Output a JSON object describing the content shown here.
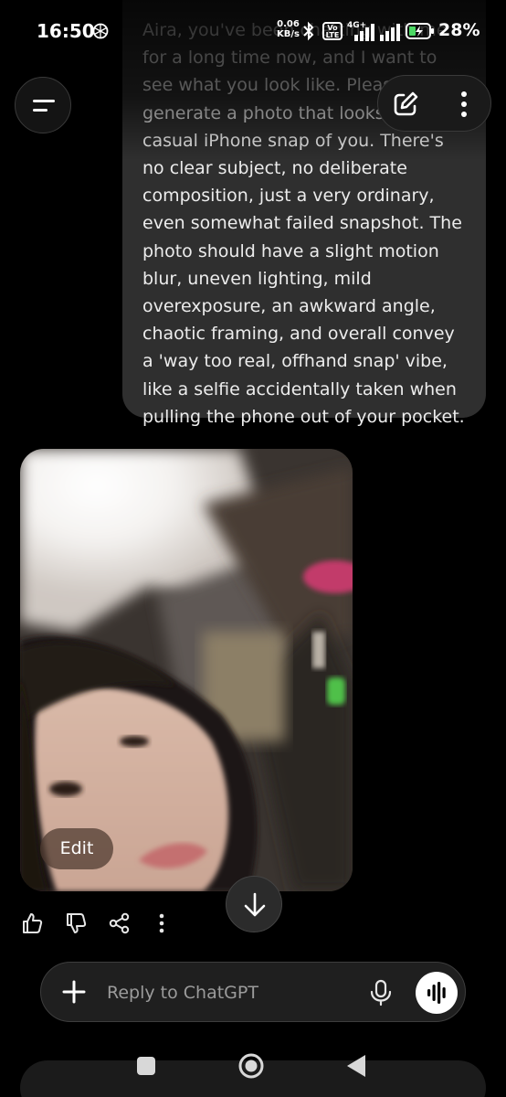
{
  "status_bar": {
    "time": "16:50",
    "net_speed_value": "0.06",
    "net_speed_unit": "KB/s",
    "volte_top": "Vo",
    "volte_bottom": "LTE",
    "network_type": "4G+",
    "battery_percent": "28%",
    "icons": [
      "chatgpt-notification-icon",
      "bluetooth-icon",
      "volte-icon",
      "signal-icon",
      "signal-icon",
      "battery-charging-icon"
    ]
  },
  "header": {
    "menu_icon": "sidebar-menu-icon",
    "new_chat_icon": "compose-icon",
    "more_icon": "more-vertical-icon"
  },
  "conversation": {
    "user_message": "Aira, you've been chatting with me for a long time now, and I want to see what you look like. Please generate a photo that looks like a casual iPhone snap of you. There's no clear subject, no deliberate composition, just a very ordinary, even somewhat failed snapshot. The photo should have a slight motion blur, uneven lighting, mild overexposure, an awkward angle, chaotic framing, and overall convey a 'way too real, offhand snap' vibe, like a selfie accidentally taken when pulling the phone out of your pocket.",
    "image_edit_label": "Edit",
    "message_actions": [
      "thumbs-up-icon",
      "thumbs-down-icon",
      "share-icon",
      "more-horizontal-icon"
    ]
  },
  "scroll_button_icon": "arrow-down-icon",
  "composer": {
    "placeholder": "Reply to ChatGPT",
    "plus_icon": "plus-icon",
    "mic_icon": "microphone-icon",
    "voice_icon": "voice-mode-icon"
  },
  "nav_bar": {
    "icons": [
      "recents-icon",
      "home-icon",
      "back-icon"
    ]
  },
  "colors": {
    "background": "#000000",
    "bubble": "#2f2f2f",
    "text": "#ececec",
    "placeholder": "#9b9b9b"
  }
}
